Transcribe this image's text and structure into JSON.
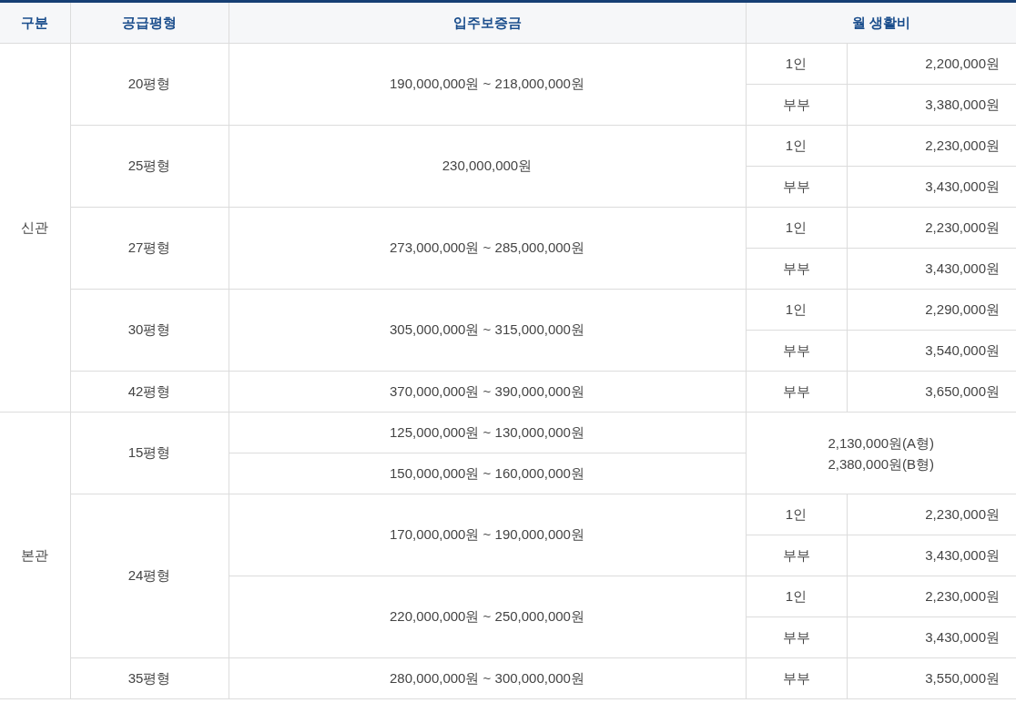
{
  "table": {
    "columns": [
      "구분",
      "공급평형",
      "입주보증금",
      "월 생활비"
    ],
    "sections": [
      {
        "name": "신관",
        "sizes": [
          {
            "kind": "split",
            "size": "20평형",
            "deposits": [
              {
                "amount": "190,000,000원 ~ 218,000,000원",
                "fees": [
                  {
                    "type": "1인",
                    "amount": "2,200,000원"
                  },
                  {
                    "type": "부부",
                    "amount": "3,380,000원"
                  }
                ]
              }
            ]
          },
          {
            "kind": "split",
            "size": "25평형",
            "deposits": [
              {
                "amount": "230,000,000원",
                "fees": [
                  {
                    "type": "1인",
                    "amount": "2,230,000원"
                  },
                  {
                    "type": "부부",
                    "amount": "3,430,000원"
                  }
                ]
              }
            ]
          },
          {
            "kind": "split",
            "size": "27평형",
            "deposits": [
              {
                "amount": "273,000,000원 ~ 285,000,000원",
                "fees": [
                  {
                    "type": "1인",
                    "amount": "2,230,000원"
                  },
                  {
                    "type": "부부",
                    "amount": "3,430,000원"
                  }
                ]
              }
            ]
          },
          {
            "kind": "split",
            "size": "30평형",
            "deposits": [
              {
                "amount": "305,000,000원 ~ 315,000,000원",
                "fees": [
                  {
                    "type": "1인",
                    "amount": "2,290,000원"
                  },
                  {
                    "type": "부부",
                    "amount": "3,540,000원"
                  }
                ]
              }
            ]
          },
          {
            "kind": "split",
            "size": "42평형",
            "deposits": [
              {
                "amount": "370,000,000원 ~ 390,000,000원",
                "fees": [
                  {
                    "type": "부부",
                    "amount": "3,650,000원"
                  }
                ]
              }
            ]
          }
        ]
      },
      {
        "name": "본관",
        "sizes": [
          {
            "kind": "combined",
            "size": "15평형",
            "deposits": [
              {
                "amount": "125,000,000원 ~ 130,000,000원"
              },
              {
                "amount": "150,000,000원 ~ 160,000,000원"
              }
            ],
            "combined_fee": [
              "2,130,000원(A형)",
              "2,380,000원(B형)"
            ]
          },
          {
            "kind": "split",
            "size": "24평형",
            "deposits": [
              {
                "amount": "170,000,000원 ~ 190,000,000원",
                "fees": [
                  {
                    "type": "1인",
                    "amount": "2,230,000원"
                  },
                  {
                    "type": "부부",
                    "amount": "3,430,000원"
                  }
                ]
              },
              {
                "amount": "220,000,000원 ~ 250,000,000원",
                "fees": [
                  {
                    "type": "1인",
                    "amount": "2,230,000원"
                  },
                  {
                    "type": "부부",
                    "amount": "3,430,000원"
                  }
                ]
              }
            ]
          },
          {
            "kind": "split",
            "size": "35평형",
            "deposits": [
              {
                "amount": "280,000,000원 ~ 300,000,000원",
                "fees": [
                  {
                    "type": "부부",
                    "amount": "3,550,000원"
                  }
                ]
              }
            ]
          }
        ]
      }
    ]
  }
}
